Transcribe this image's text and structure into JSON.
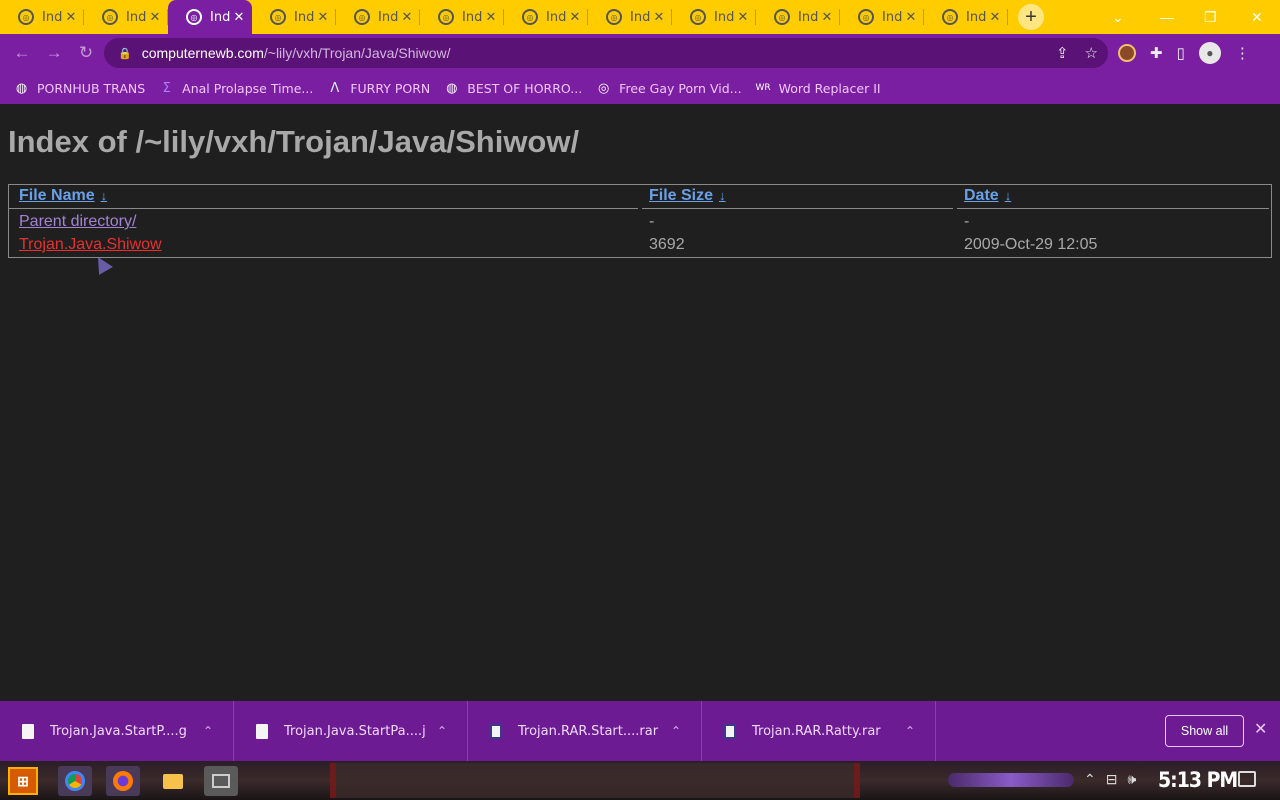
{
  "browser": {
    "tabs": [
      {
        "title": "Ind",
        "active": false
      },
      {
        "title": "Ind",
        "active": false
      },
      {
        "title": "Ind",
        "active": true
      },
      {
        "title": "Ind",
        "active": false
      },
      {
        "title": "Ind",
        "active": false
      },
      {
        "title": "Ind",
        "active": false
      },
      {
        "title": "Ind",
        "active": false
      },
      {
        "title": "Ind",
        "active": false
      },
      {
        "title": "Ind",
        "active": false
      },
      {
        "title": "Ind",
        "active": false
      },
      {
        "title": "Ind",
        "active": false
      },
      {
        "title": "Ind",
        "active": false
      }
    ],
    "new_tab_glyph": "+",
    "url_host": "computernewb.com",
    "url_path": "/~lily/vxh/Trojan/Java/Shiwow/",
    "bookmarks": [
      {
        "label": "PORNHUB TRANS",
        "icon": "globe-icon"
      },
      {
        "label": "Anal Prolapse Time...",
        "icon": "sigma-icon"
      },
      {
        "label": "FURRY PORN",
        "icon": "lambda-icon"
      },
      {
        "label": "BEST OF HORRO...",
        "icon": "globe-icon"
      },
      {
        "label": "Free Gay Porn Vid...",
        "icon": "site-icon"
      },
      {
        "label": "Word Replacer II",
        "icon": "wr-icon"
      }
    ],
    "theme_colors": {
      "tabstrip": "#ffcc00",
      "toolbar": "#7a1fa2"
    }
  },
  "page": {
    "heading": "Index of /~lily/vxh/Trojan/Java/Shiwow/",
    "columns": {
      "name": "File Name",
      "size": "File Size",
      "date": "Date",
      "sort_arrow": "↓"
    },
    "rows": [
      {
        "name": "Parent directory/",
        "size": "-",
        "date": "-"
      },
      {
        "name": "Trojan.Java.Shiwow",
        "size": "3692",
        "date": "2009-Oct-29 12:05"
      }
    ]
  },
  "downloads": {
    "items": [
      {
        "name": "Trojan.Java.StartP....g",
        "type": "file"
      },
      {
        "name": "Trojan.Java.StartPa....j",
        "type": "file"
      },
      {
        "name": "Trojan.RAR.Start....rar",
        "type": "rar"
      },
      {
        "name": "Trojan.RAR.Ratty.rar",
        "type": "rar"
      }
    ],
    "show_all_label": "Show all"
  },
  "taskbar": {
    "clock": "5:13 PM"
  }
}
